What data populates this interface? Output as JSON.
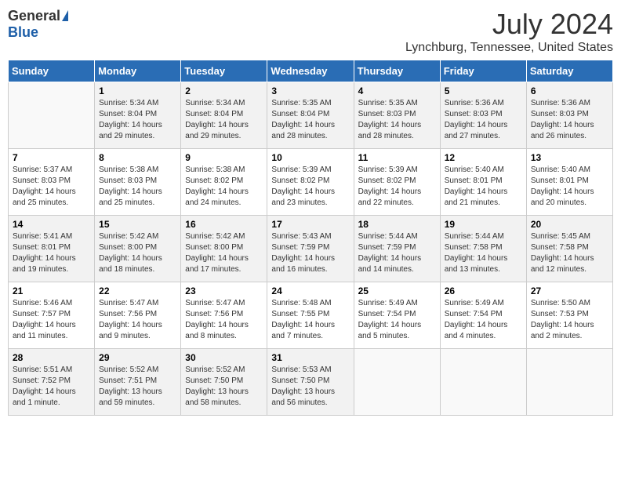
{
  "header": {
    "logo_general": "General",
    "logo_blue": "Blue",
    "title": "July 2024",
    "subtitle": "Lynchburg, Tennessee, United States"
  },
  "weekdays": [
    "Sunday",
    "Monday",
    "Tuesday",
    "Wednesday",
    "Thursday",
    "Friday",
    "Saturday"
  ],
  "weeks": [
    [
      {
        "day": "",
        "info": ""
      },
      {
        "day": "1",
        "info": "Sunrise: 5:34 AM\nSunset: 8:04 PM\nDaylight: 14 hours\nand 29 minutes."
      },
      {
        "day": "2",
        "info": "Sunrise: 5:34 AM\nSunset: 8:04 PM\nDaylight: 14 hours\nand 29 minutes."
      },
      {
        "day": "3",
        "info": "Sunrise: 5:35 AM\nSunset: 8:04 PM\nDaylight: 14 hours\nand 28 minutes."
      },
      {
        "day": "4",
        "info": "Sunrise: 5:35 AM\nSunset: 8:03 PM\nDaylight: 14 hours\nand 28 minutes."
      },
      {
        "day": "5",
        "info": "Sunrise: 5:36 AM\nSunset: 8:03 PM\nDaylight: 14 hours\nand 27 minutes."
      },
      {
        "day": "6",
        "info": "Sunrise: 5:36 AM\nSunset: 8:03 PM\nDaylight: 14 hours\nand 26 minutes."
      }
    ],
    [
      {
        "day": "7",
        "info": "Sunrise: 5:37 AM\nSunset: 8:03 PM\nDaylight: 14 hours\nand 25 minutes."
      },
      {
        "day": "8",
        "info": "Sunrise: 5:38 AM\nSunset: 8:03 PM\nDaylight: 14 hours\nand 25 minutes."
      },
      {
        "day": "9",
        "info": "Sunrise: 5:38 AM\nSunset: 8:02 PM\nDaylight: 14 hours\nand 24 minutes."
      },
      {
        "day": "10",
        "info": "Sunrise: 5:39 AM\nSunset: 8:02 PM\nDaylight: 14 hours\nand 23 minutes."
      },
      {
        "day": "11",
        "info": "Sunrise: 5:39 AM\nSunset: 8:02 PM\nDaylight: 14 hours\nand 22 minutes."
      },
      {
        "day": "12",
        "info": "Sunrise: 5:40 AM\nSunset: 8:01 PM\nDaylight: 14 hours\nand 21 minutes."
      },
      {
        "day": "13",
        "info": "Sunrise: 5:40 AM\nSunset: 8:01 PM\nDaylight: 14 hours\nand 20 minutes."
      }
    ],
    [
      {
        "day": "14",
        "info": "Sunrise: 5:41 AM\nSunset: 8:01 PM\nDaylight: 14 hours\nand 19 minutes."
      },
      {
        "day": "15",
        "info": "Sunrise: 5:42 AM\nSunset: 8:00 PM\nDaylight: 14 hours\nand 18 minutes."
      },
      {
        "day": "16",
        "info": "Sunrise: 5:42 AM\nSunset: 8:00 PM\nDaylight: 14 hours\nand 17 minutes."
      },
      {
        "day": "17",
        "info": "Sunrise: 5:43 AM\nSunset: 7:59 PM\nDaylight: 14 hours\nand 16 minutes."
      },
      {
        "day": "18",
        "info": "Sunrise: 5:44 AM\nSunset: 7:59 PM\nDaylight: 14 hours\nand 14 minutes."
      },
      {
        "day": "19",
        "info": "Sunrise: 5:44 AM\nSunset: 7:58 PM\nDaylight: 14 hours\nand 13 minutes."
      },
      {
        "day": "20",
        "info": "Sunrise: 5:45 AM\nSunset: 7:58 PM\nDaylight: 14 hours\nand 12 minutes."
      }
    ],
    [
      {
        "day": "21",
        "info": "Sunrise: 5:46 AM\nSunset: 7:57 PM\nDaylight: 14 hours\nand 11 minutes."
      },
      {
        "day": "22",
        "info": "Sunrise: 5:47 AM\nSunset: 7:56 PM\nDaylight: 14 hours\nand 9 minutes."
      },
      {
        "day": "23",
        "info": "Sunrise: 5:47 AM\nSunset: 7:56 PM\nDaylight: 14 hours\nand 8 minutes."
      },
      {
        "day": "24",
        "info": "Sunrise: 5:48 AM\nSunset: 7:55 PM\nDaylight: 14 hours\nand 7 minutes."
      },
      {
        "day": "25",
        "info": "Sunrise: 5:49 AM\nSunset: 7:54 PM\nDaylight: 14 hours\nand 5 minutes."
      },
      {
        "day": "26",
        "info": "Sunrise: 5:49 AM\nSunset: 7:54 PM\nDaylight: 14 hours\nand 4 minutes."
      },
      {
        "day": "27",
        "info": "Sunrise: 5:50 AM\nSunset: 7:53 PM\nDaylight: 14 hours\nand 2 minutes."
      }
    ],
    [
      {
        "day": "28",
        "info": "Sunrise: 5:51 AM\nSunset: 7:52 PM\nDaylight: 14 hours\nand 1 minute."
      },
      {
        "day": "29",
        "info": "Sunrise: 5:52 AM\nSunset: 7:51 PM\nDaylight: 13 hours\nand 59 minutes."
      },
      {
        "day": "30",
        "info": "Sunrise: 5:52 AM\nSunset: 7:50 PM\nDaylight: 13 hours\nand 58 minutes."
      },
      {
        "day": "31",
        "info": "Sunrise: 5:53 AM\nSunset: 7:50 PM\nDaylight: 13 hours\nand 56 minutes."
      },
      {
        "day": "",
        "info": ""
      },
      {
        "day": "",
        "info": ""
      },
      {
        "day": "",
        "info": ""
      }
    ]
  ]
}
